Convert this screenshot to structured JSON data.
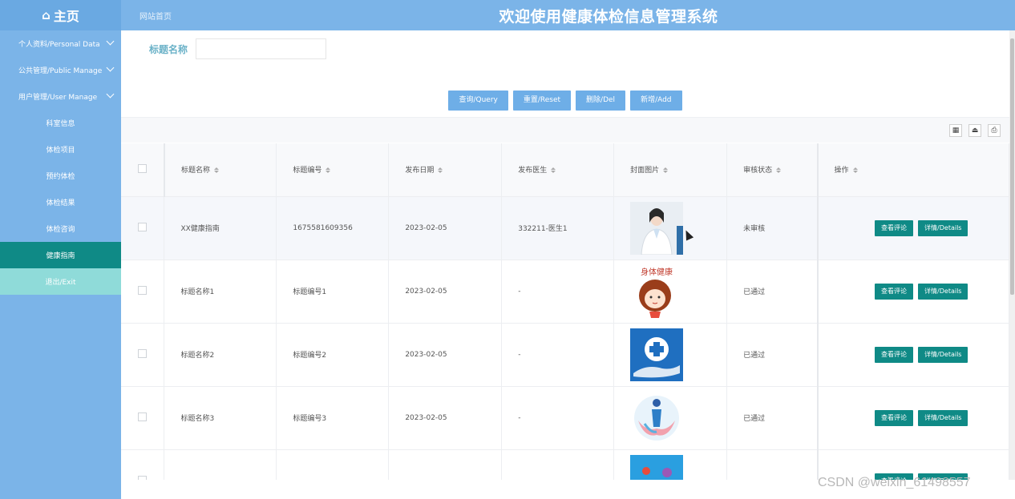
{
  "brand": {
    "icon": "home-icon",
    "label": "主页"
  },
  "breadcrumb": "网站首页",
  "system_title": "欢迎使用健康体检信息管理系统",
  "sidebar": {
    "items": [
      {
        "label": "个人资料/Personal Data",
        "type": "group"
      },
      {
        "label": "公共管理/Public Manage",
        "type": "group"
      },
      {
        "label": "用户管理/User Manage",
        "type": "group"
      },
      {
        "label": "科室信息",
        "type": "item"
      },
      {
        "label": "体检项目",
        "type": "item"
      },
      {
        "label": "预约体检",
        "type": "item"
      },
      {
        "label": "体检结果",
        "type": "item"
      },
      {
        "label": "体检咨询",
        "type": "item"
      },
      {
        "label": "健康指南",
        "type": "active"
      },
      {
        "label": "退出/Exit",
        "type": "exit"
      }
    ]
  },
  "search": {
    "label": "标题名称",
    "value": ""
  },
  "buttons": {
    "query": "查询/Query",
    "reset": "重置/Reset",
    "delete": "删除/Del",
    "add": "新增/Add"
  },
  "table": {
    "headers": [
      "标题名称",
      "标题编号",
      "发布日期",
      "发布医生",
      "封面图片",
      "审核状态",
      "操作"
    ],
    "rows": [
      {
        "title": "XX健康指南",
        "code": "1675581609356",
        "date": "2023-02-05",
        "doctor": "332211-医生1",
        "status": "未审核"
      },
      {
        "title": "标题名称1",
        "code": "标题编号1",
        "date": "2023-02-05",
        "doctor": "-",
        "status": "已通过"
      },
      {
        "title": "标题名称2",
        "code": "标题编号2",
        "date": "2023-02-05",
        "doctor": "-",
        "status": "已通过"
      },
      {
        "title": "标题名称3",
        "code": "标题编号3",
        "date": "2023-02-05",
        "doctor": "-",
        "status": "已通过"
      }
    ],
    "view_comments_label": "查看评论",
    "details_label": "详情/Details"
  },
  "thumb2_text": "身体健康",
  "watermark": "CSDN @weixin_61498557",
  "colors": {
    "topbar": "#7bb4e8",
    "active": "#0f8a86",
    "exit": "#8fdbd9",
    "button": "#6eaee7",
    "op_button": "#0f8a86"
  }
}
